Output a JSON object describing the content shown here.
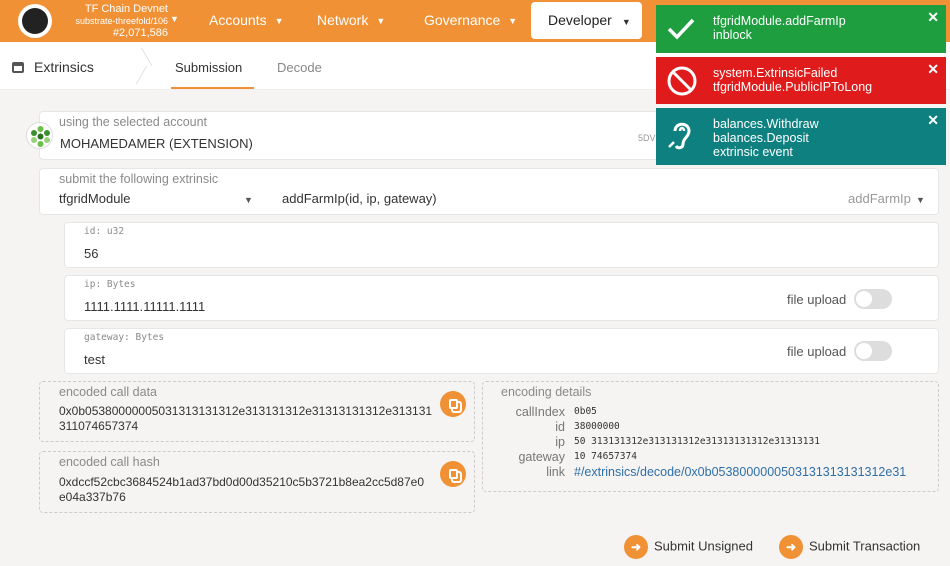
{
  "header": {
    "chain_name": "TF Chain Devnet",
    "chain_spec": "substrate-threefold/106",
    "block": "#2,071,586",
    "nav": [
      {
        "label": "Accounts"
      },
      {
        "label": "Network"
      },
      {
        "label": "Governance"
      },
      {
        "label": "Developer"
      }
    ]
  },
  "tabs": {
    "section": "Extrinsics",
    "items": [
      {
        "label": "Submission"
      },
      {
        "label": "Decode"
      }
    ]
  },
  "account": {
    "label": "using the selected account",
    "value": "MOHAMEDAMER (EXTENSION)",
    "address_fragment": "5DV"
  },
  "extrinsic": {
    "label": "submit the following extrinsic",
    "module": "tfgridModule",
    "call": "addFarmIp(id, ip, gateway)",
    "call_name": "addFarmIp"
  },
  "params": [
    {
      "label": "id: u32",
      "value": "56"
    },
    {
      "label": "ip: Bytes",
      "value": "1111.1111.11111.1111",
      "toggle_label": "file upload"
    },
    {
      "label": "gateway: Bytes",
      "value": "test",
      "toggle_label": "file upload"
    }
  ],
  "encoded_call": {
    "label": "encoded call data",
    "line1": "0x0b05380000005031313131312e313131312e31313131312e313131",
    "line2": "311074657374"
  },
  "call_hash": {
    "label": "encoded call hash",
    "line1": "0xdccf52cbc3684524b1ad37bd0d00d35210c5b3721b8ea2cc5d87e0",
    "line2": "e04a337b76"
  },
  "details": {
    "label": "encoding details",
    "rows": [
      {
        "key": "callIndex",
        "value": "0b05"
      },
      {
        "key": "id",
        "value": "38000000"
      },
      {
        "key": "ip",
        "value": "50 313131312e313131312e31313131312e31313131"
      },
      {
        "key": "gateway",
        "value": "10 74657374"
      },
      {
        "key": "link",
        "value": "#/extrinsics/decode/0x0b0538000000503131313131312e31"
      }
    ]
  },
  "actions": {
    "unsigned": "Submit Unsigned",
    "transaction": "Submit Transaction"
  },
  "toasts": [
    {
      "line1": "tfgridModule.addFarmIp",
      "line2": "inblock",
      "color": "#1e9e3e",
      "icon": "check-icon"
    },
    {
      "line1": "system.ExtrinsicFailed",
      "line2": "tfgridModule.PublicIPToLong",
      "color": "#e01b1b",
      "icon": "blocked-icon"
    },
    {
      "line1": "balances.Withdraw",
      "line2": "balances.Deposit",
      "line3": "extrinsic event",
      "color": "#0e8080",
      "icon": "listen-icon"
    }
  ]
}
